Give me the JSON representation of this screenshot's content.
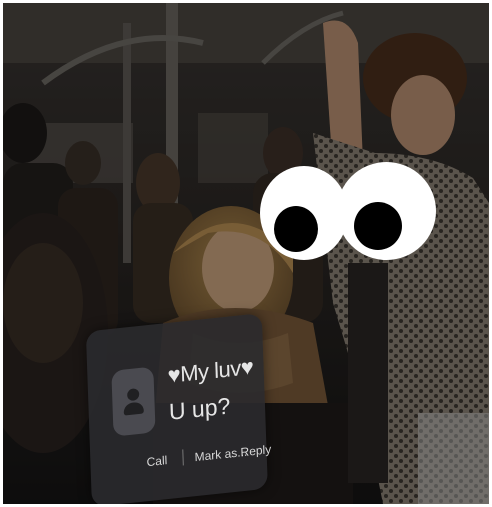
{
  "notification": {
    "sender": "♥My luv♥",
    "message": "U up?",
    "actions": {
      "call": "Call",
      "mark_as": "Mark as...",
      "reply": "Reply"
    },
    "contact_icon": "person-icon"
  },
  "overlay_icon": "googly-eyes-icon",
  "colors": {
    "card": "#2a2a2e",
    "text": "#e6e6e6",
    "eye_white": "#ffffff",
    "pupil": "#000000"
  }
}
